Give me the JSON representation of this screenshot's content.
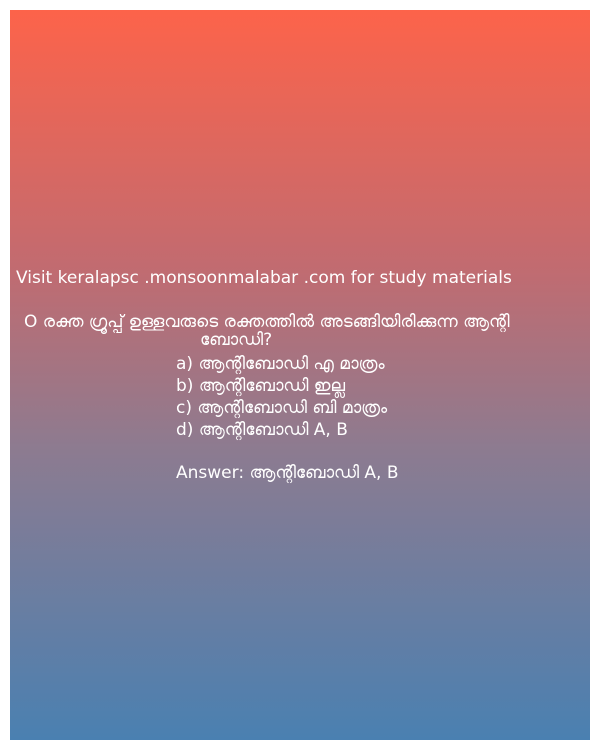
{
  "site_text": "Visit keralapsc .monsoonmalabar .com for study materials",
  "question": {
    "line1": "O രക്ത ഗ്രൂപ്പ് ഉള്ളവരുടെ രക്തത്തിൽ അടങ്ങിയിരിക്കുന്ന ആന്റി",
    "line2": "ബോഡി?"
  },
  "options": [
    "a) ആന്റിബോഡി എ മാത്രം",
    "b) ആന്റിബോഡി ഇല്ല",
    "c) ആന്റിബോഡി ബി മാത്രം",
    "d) ആന്റിബോഡി A, B"
  ],
  "answer": "Answer: ആന്റിബോഡി A, B",
  "colors": {
    "gradient_top": "#fd634a",
    "gradient_bottom": "#4a80b1",
    "text": "#ffffff"
  }
}
